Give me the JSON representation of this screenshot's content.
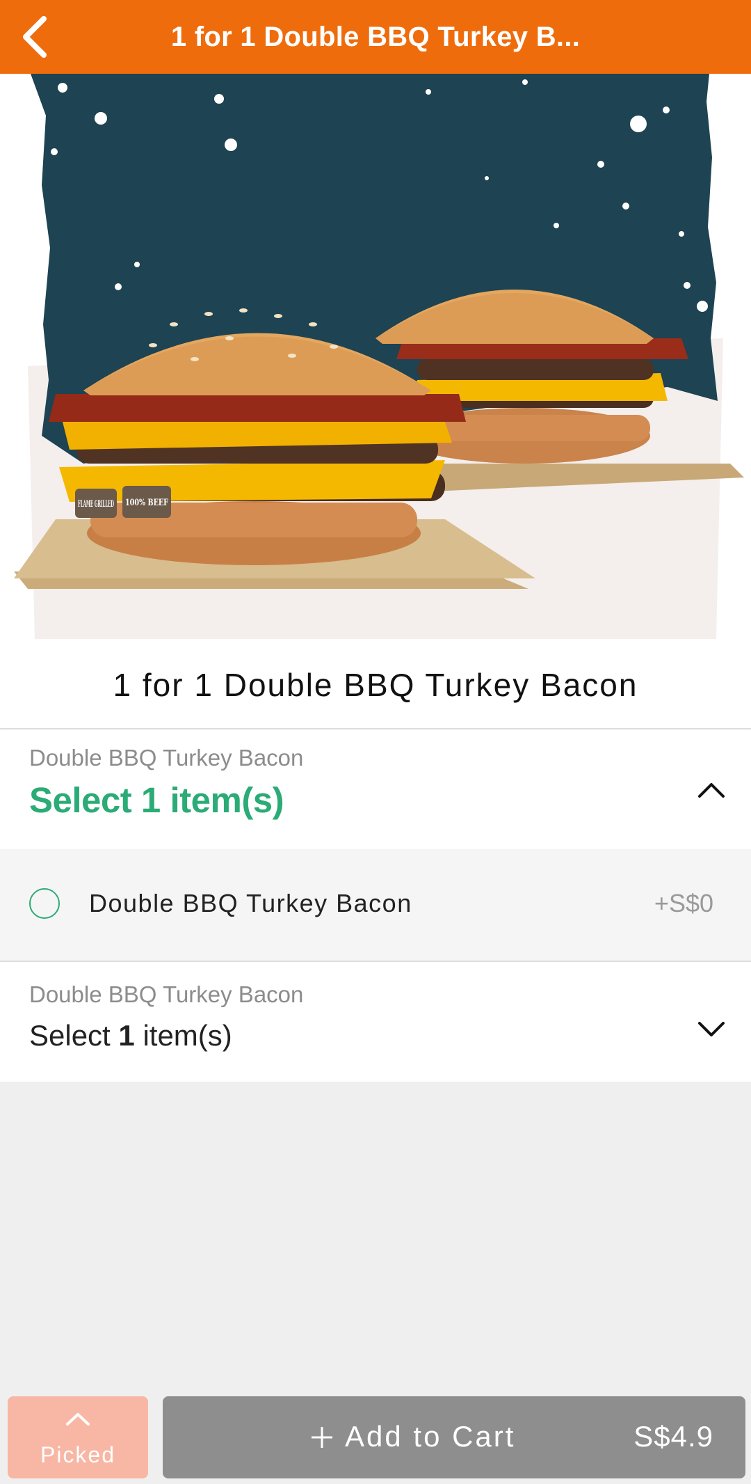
{
  "header": {
    "title": "1 for 1 Double BBQ Turkey B...",
    "back_icon": "chevron-left-icon"
  },
  "product": {
    "image_alt": "Two Double BBQ Turkey Bacon burgers",
    "badge_text_1": "FLAME GRILLED",
    "badge_text_2": "100% BEEF",
    "name": "1 for 1 Double BBQ Turkey Bacon"
  },
  "groups": [
    {
      "subtitle": "Double BBQ Turkey Bacon",
      "title": "Select 1 item(s)",
      "expanded": true,
      "chevron": "chevron-up-icon",
      "options": [
        {
          "label": "Double BBQ Turkey Bacon",
          "price": "+S$0",
          "selected": false
        }
      ]
    },
    {
      "subtitle": "Double BBQ Turkey Bacon",
      "title_prefix": "Select",
      "title_count": "1",
      "title_suffix": "item(s)",
      "expanded": false,
      "chevron": "chevron-down-icon"
    }
  ],
  "footer": {
    "picked_label": "Picked",
    "add_to_cart_label": "Add to Cart",
    "total_price": "S$4.9"
  },
  "colors": {
    "brand_orange": "#ef6c0c",
    "accent_green": "#2bab75",
    "picked_bg": "#f8b7a4",
    "cart_bg": "#8e8e8e"
  }
}
